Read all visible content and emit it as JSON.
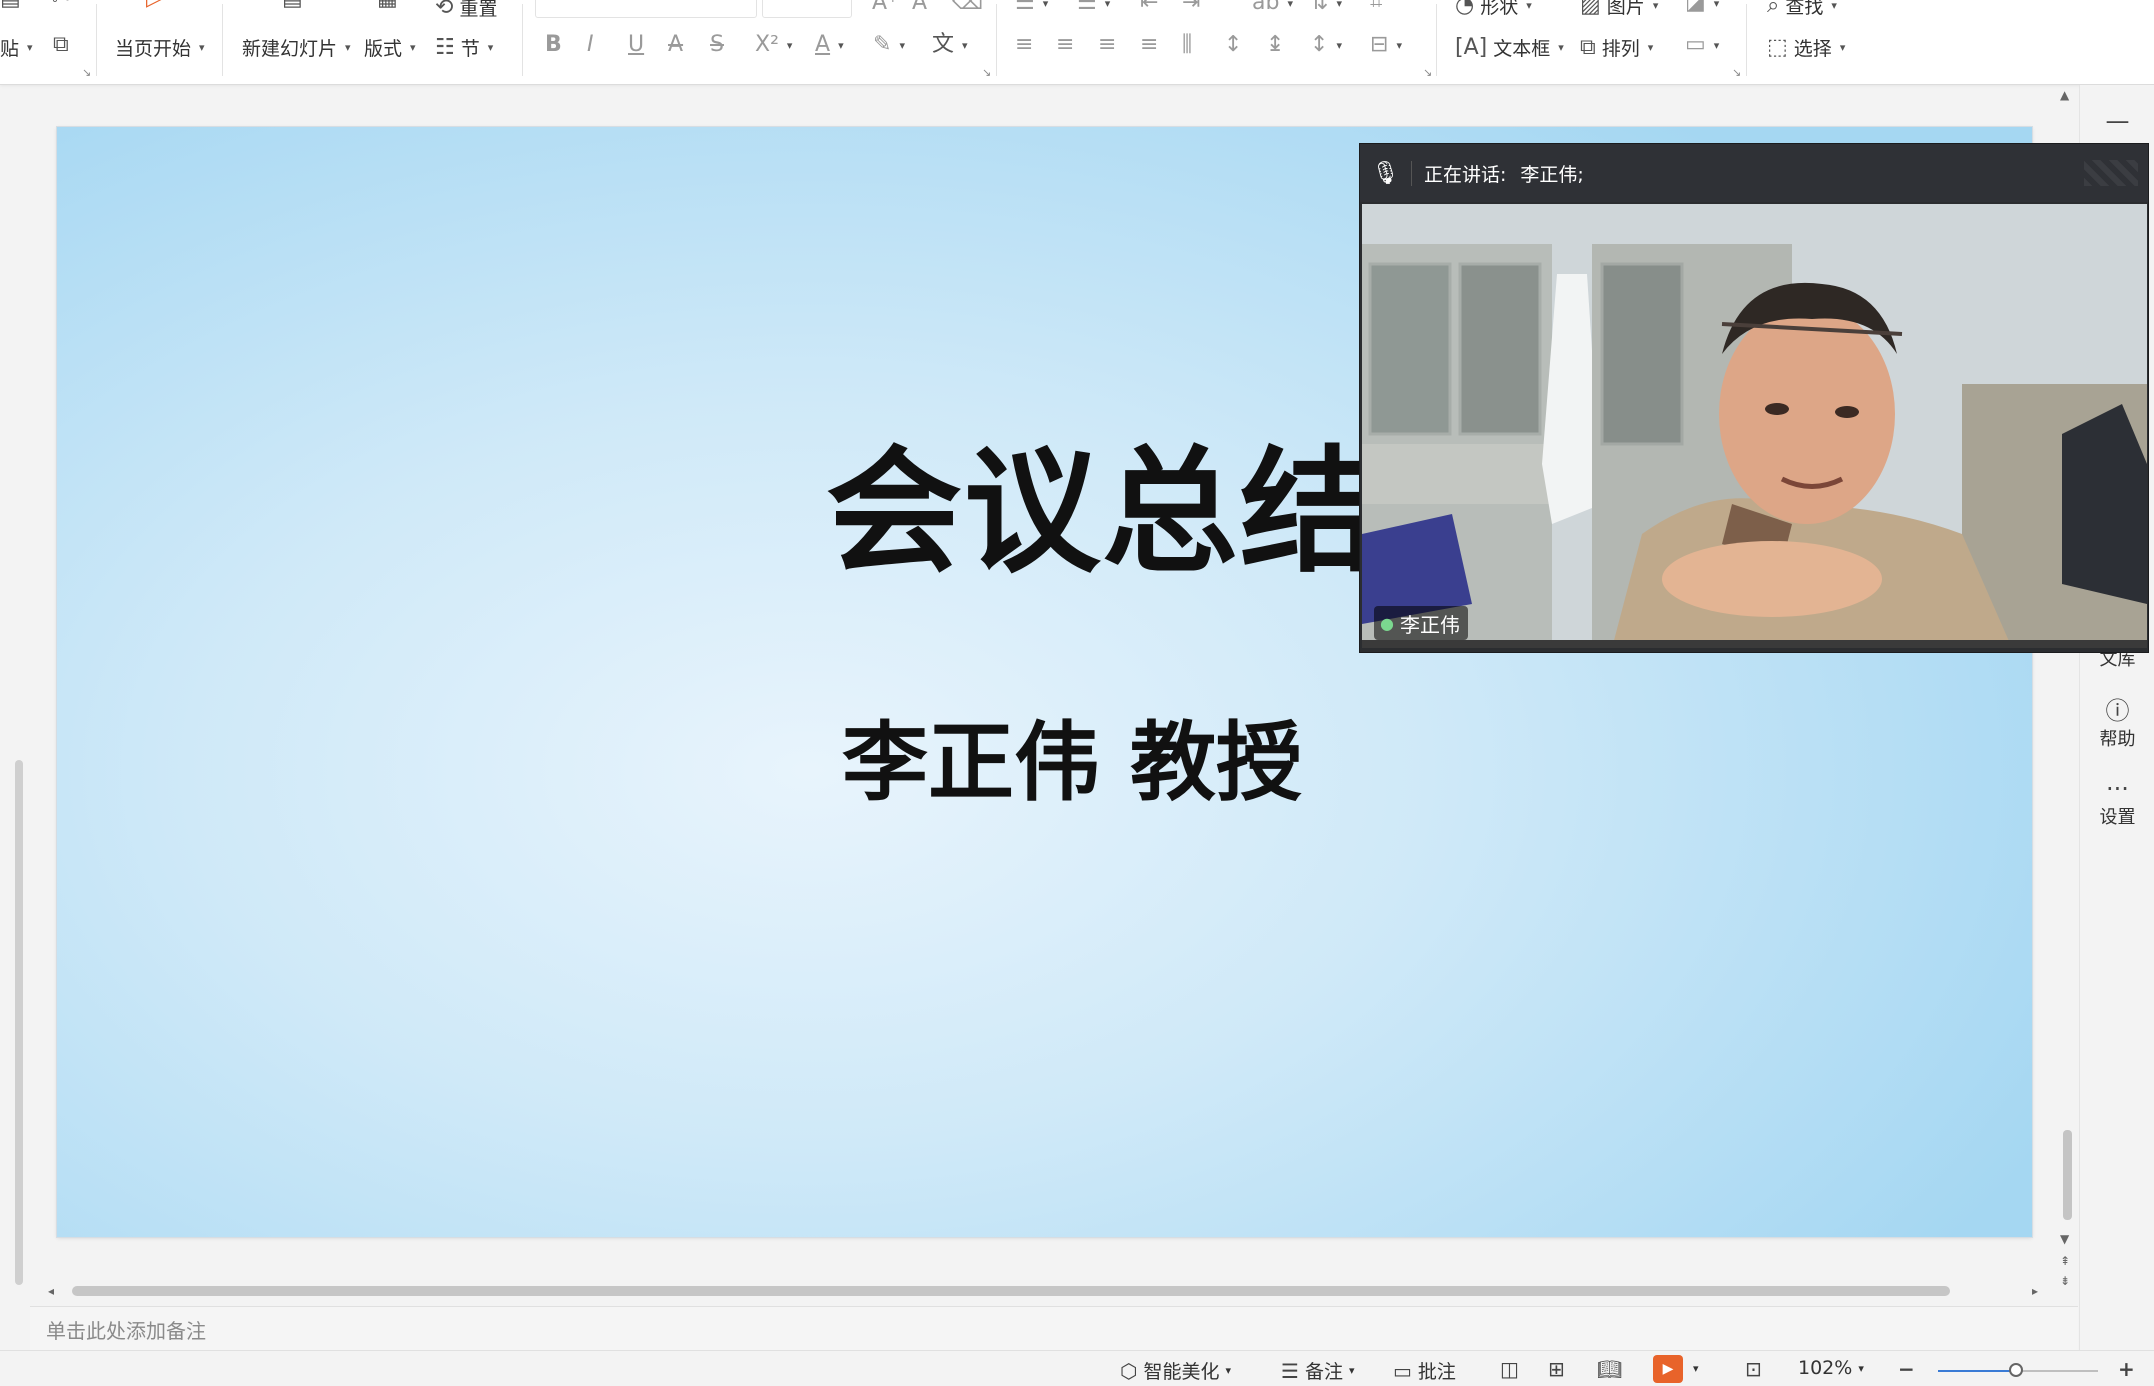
{
  "ribbon": {
    "paste_label": "贴",
    "start_slideshow_label": "当页开始",
    "new_slide_label": "新建幻灯片",
    "layout_label": "版式",
    "section_label": "节",
    "reset_label": "重置",
    "shape_label": "形状",
    "picture_label": "图片",
    "textbox_label": "文本框",
    "arrange_label": "排列",
    "find_label": "查找",
    "select_label": "选择"
  },
  "rail": {
    "library_label": "文库",
    "help_label": "帮助",
    "settings_label": "设置"
  },
  "slide": {
    "title": "会议总结",
    "subtitle": "李正伟 教授"
  },
  "video": {
    "speaking_label": "正在讲话:",
    "speaker_names": "李正伟;",
    "participant_name": "李正伟"
  },
  "notes": {
    "placeholder": "单击此处添加备注"
  },
  "status": {
    "beautify_label": "智能美化",
    "notes_label": "备注",
    "comments_label": "批注",
    "zoom_level": "102%",
    "zoom_fraction": 0.49
  },
  "colors": {
    "slideshow_accent": "#e8632a",
    "zoom_accent": "#3a7bd5",
    "slide_bg_light": "#e8f4fc",
    "slide_bg_dark": "#a5d7f2"
  }
}
